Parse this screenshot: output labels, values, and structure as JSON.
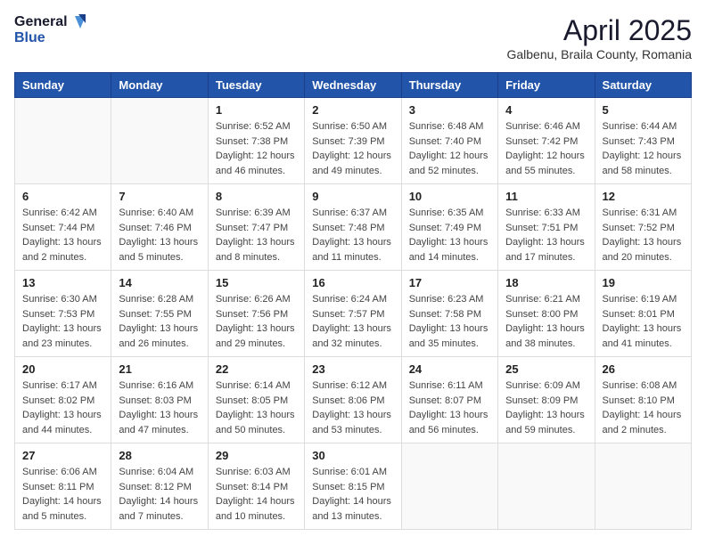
{
  "header": {
    "logo_general": "General",
    "logo_blue": "Blue",
    "title": "April 2025",
    "subtitle": "Galbenu, Braila County, Romania"
  },
  "weekdays": [
    "Sunday",
    "Monday",
    "Tuesday",
    "Wednesday",
    "Thursday",
    "Friday",
    "Saturday"
  ],
  "weeks": [
    [
      {
        "day": "",
        "info": ""
      },
      {
        "day": "",
        "info": ""
      },
      {
        "day": "1",
        "info": "Sunrise: 6:52 AM\nSunset: 7:38 PM\nDaylight: 12 hours and 46 minutes."
      },
      {
        "day": "2",
        "info": "Sunrise: 6:50 AM\nSunset: 7:39 PM\nDaylight: 12 hours and 49 minutes."
      },
      {
        "day": "3",
        "info": "Sunrise: 6:48 AM\nSunset: 7:40 PM\nDaylight: 12 hours and 52 minutes."
      },
      {
        "day": "4",
        "info": "Sunrise: 6:46 AM\nSunset: 7:42 PM\nDaylight: 12 hours and 55 minutes."
      },
      {
        "day": "5",
        "info": "Sunrise: 6:44 AM\nSunset: 7:43 PM\nDaylight: 12 hours and 58 minutes."
      }
    ],
    [
      {
        "day": "6",
        "info": "Sunrise: 6:42 AM\nSunset: 7:44 PM\nDaylight: 13 hours and 2 minutes."
      },
      {
        "day": "7",
        "info": "Sunrise: 6:40 AM\nSunset: 7:46 PM\nDaylight: 13 hours and 5 minutes."
      },
      {
        "day": "8",
        "info": "Sunrise: 6:39 AM\nSunset: 7:47 PM\nDaylight: 13 hours and 8 minutes."
      },
      {
        "day": "9",
        "info": "Sunrise: 6:37 AM\nSunset: 7:48 PM\nDaylight: 13 hours and 11 minutes."
      },
      {
        "day": "10",
        "info": "Sunrise: 6:35 AM\nSunset: 7:49 PM\nDaylight: 13 hours and 14 minutes."
      },
      {
        "day": "11",
        "info": "Sunrise: 6:33 AM\nSunset: 7:51 PM\nDaylight: 13 hours and 17 minutes."
      },
      {
        "day": "12",
        "info": "Sunrise: 6:31 AM\nSunset: 7:52 PM\nDaylight: 13 hours and 20 minutes."
      }
    ],
    [
      {
        "day": "13",
        "info": "Sunrise: 6:30 AM\nSunset: 7:53 PM\nDaylight: 13 hours and 23 minutes."
      },
      {
        "day": "14",
        "info": "Sunrise: 6:28 AM\nSunset: 7:55 PM\nDaylight: 13 hours and 26 minutes."
      },
      {
        "day": "15",
        "info": "Sunrise: 6:26 AM\nSunset: 7:56 PM\nDaylight: 13 hours and 29 minutes."
      },
      {
        "day": "16",
        "info": "Sunrise: 6:24 AM\nSunset: 7:57 PM\nDaylight: 13 hours and 32 minutes."
      },
      {
        "day": "17",
        "info": "Sunrise: 6:23 AM\nSunset: 7:58 PM\nDaylight: 13 hours and 35 minutes."
      },
      {
        "day": "18",
        "info": "Sunrise: 6:21 AM\nSunset: 8:00 PM\nDaylight: 13 hours and 38 minutes."
      },
      {
        "day": "19",
        "info": "Sunrise: 6:19 AM\nSunset: 8:01 PM\nDaylight: 13 hours and 41 minutes."
      }
    ],
    [
      {
        "day": "20",
        "info": "Sunrise: 6:17 AM\nSunset: 8:02 PM\nDaylight: 13 hours and 44 minutes."
      },
      {
        "day": "21",
        "info": "Sunrise: 6:16 AM\nSunset: 8:03 PM\nDaylight: 13 hours and 47 minutes."
      },
      {
        "day": "22",
        "info": "Sunrise: 6:14 AM\nSunset: 8:05 PM\nDaylight: 13 hours and 50 minutes."
      },
      {
        "day": "23",
        "info": "Sunrise: 6:12 AM\nSunset: 8:06 PM\nDaylight: 13 hours and 53 minutes."
      },
      {
        "day": "24",
        "info": "Sunrise: 6:11 AM\nSunset: 8:07 PM\nDaylight: 13 hours and 56 minutes."
      },
      {
        "day": "25",
        "info": "Sunrise: 6:09 AM\nSunset: 8:09 PM\nDaylight: 13 hours and 59 minutes."
      },
      {
        "day": "26",
        "info": "Sunrise: 6:08 AM\nSunset: 8:10 PM\nDaylight: 14 hours and 2 minutes."
      }
    ],
    [
      {
        "day": "27",
        "info": "Sunrise: 6:06 AM\nSunset: 8:11 PM\nDaylight: 14 hours and 5 minutes."
      },
      {
        "day": "28",
        "info": "Sunrise: 6:04 AM\nSunset: 8:12 PM\nDaylight: 14 hours and 7 minutes."
      },
      {
        "day": "29",
        "info": "Sunrise: 6:03 AM\nSunset: 8:14 PM\nDaylight: 14 hours and 10 minutes."
      },
      {
        "day": "30",
        "info": "Sunrise: 6:01 AM\nSunset: 8:15 PM\nDaylight: 14 hours and 13 minutes."
      },
      {
        "day": "",
        "info": ""
      },
      {
        "day": "",
        "info": ""
      },
      {
        "day": "",
        "info": ""
      }
    ]
  ]
}
